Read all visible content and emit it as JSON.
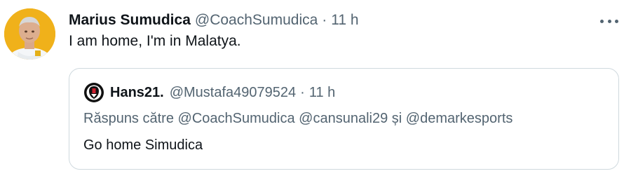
{
  "tweet": {
    "author_name": "Marius Sumudica",
    "author_handle": "@CoachSumudica",
    "separator": "·",
    "time": "11 h",
    "text": "I am home, I'm in Malatya."
  },
  "quoted": {
    "author_name": "Hans21.",
    "author_handle": "@Mustafa49079524",
    "separator": "·",
    "time": "11 h",
    "reply_prefix": "Răspuns către",
    "reply_mentions": [
      "@CoachSumudica",
      "@cansunali29"
    ],
    "reply_conjunction": "și",
    "reply_last_mention": "@demarkesports",
    "text": "Go home Simudica"
  },
  "icons": {
    "more": "more-horizontal-icon"
  },
  "colors": {
    "text_primary": "#0f1419",
    "text_secondary": "#536471",
    "border": "#cfd9de"
  }
}
